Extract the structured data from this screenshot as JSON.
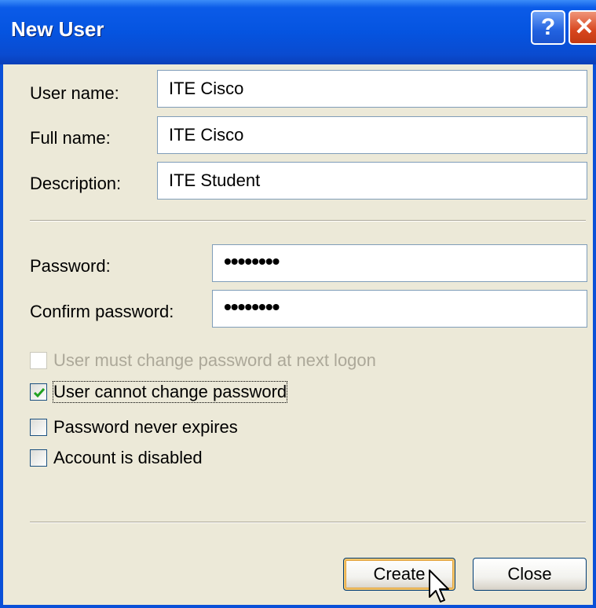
{
  "window": {
    "title": "New User",
    "help_glyph": "?",
    "close_glyph": "✕"
  },
  "fields": [
    {
      "label": "User name:",
      "value": "ITE Cisco"
    },
    {
      "label": "Full name:",
      "value": "ITE Cisco"
    },
    {
      "label": "Description:",
      "value": "ITE Student"
    }
  ],
  "password": {
    "label": "Password:",
    "value": "••••••••"
  },
  "confirm_password": {
    "label": "Confirm password:",
    "value": "••••••••"
  },
  "options": [
    {
      "label": "User must change password at next logon",
      "checked": false,
      "disabled": true
    },
    {
      "label": "User cannot change password",
      "checked": true,
      "disabled": false
    },
    {
      "label": "Password never expires",
      "checked": false,
      "disabled": false
    },
    {
      "label": "Account is disabled",
      "checked": false,
      "disabled": false
    }
  ],
  "buttons": {
    "create": "Create",
    "close": "Close"
  },
  "icons": {
    "help": "help-icon",
    "close": "close-icon",
    "check": "checkmark-icon",
    "cursor": "mouse-pointer-icon"
  },
  "colors": {
    "titlebar": "#0554E0",
    "dialog_bg": "#ECE9D8",
    "check": "#21A121",
    "close_button": "#D8461E"
  }
}
